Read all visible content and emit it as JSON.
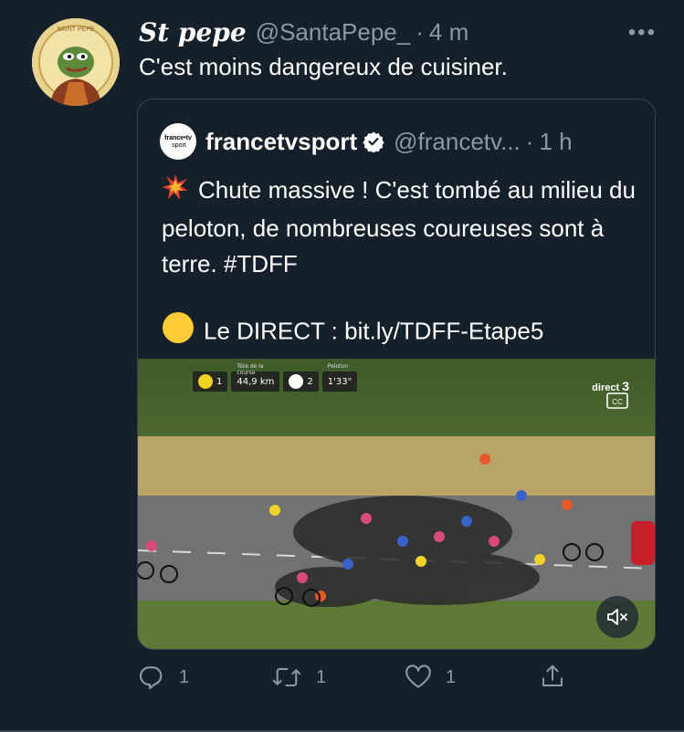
{
  "tweet": {
    "display_name": "St pepe",
    "handle": "@SantaPepe_",
    "dot": "·",
    "time": "4 m",
    "more": "•••",
    "text": "C'est moins dangereux de cuisiner.",
    "avatar_label": "SAINT PEPE"
  },
  "quoted": {
    "avatar_text_top": "france•tv",
    "avatar_text_bottom": "sport",
    "name": "francetvsport",
    "handle": "@francetv...",
    "dot": "·",
    "time": "1 h",
    "text_line": "Chute massive ! C'est tombé au milieu du peloton, de nombreuses coureuses sont à terre. #TDFF",
    "link_label": "Le DIRECT : bit.ly/TDFF-Etape5",
    "video": {
      "pos1": "1",
      "distance": "44,9 km",
      "pos2": "2",
      "gap": "1'33\"",
      "caption1": "Tête de la course",
      "caption2": "Peloton",
      "channel": "direct",
      "channel_num": "3"
    }
  },
  "actions": {
    "reply_count": "1",
    "retweet_count": "1",
    "like_count": "1"
  },
  "colors": {
    "background": "#15202b",
    "secondary_text": "#8b98a5",
    "border": "#38444d",
    "verified": "#ffffff"
  },
  "icons": [
    "more-icon",
    "verified-icon",
    "collision-emoji-icon",
    "yellow-circle-emoji-icon",
    "closed-captions-icon",
    "mute-icon",
    "reply-icon",
    "retweet-icon",
    "like-icon",
    "share-icon"
  ]
}
